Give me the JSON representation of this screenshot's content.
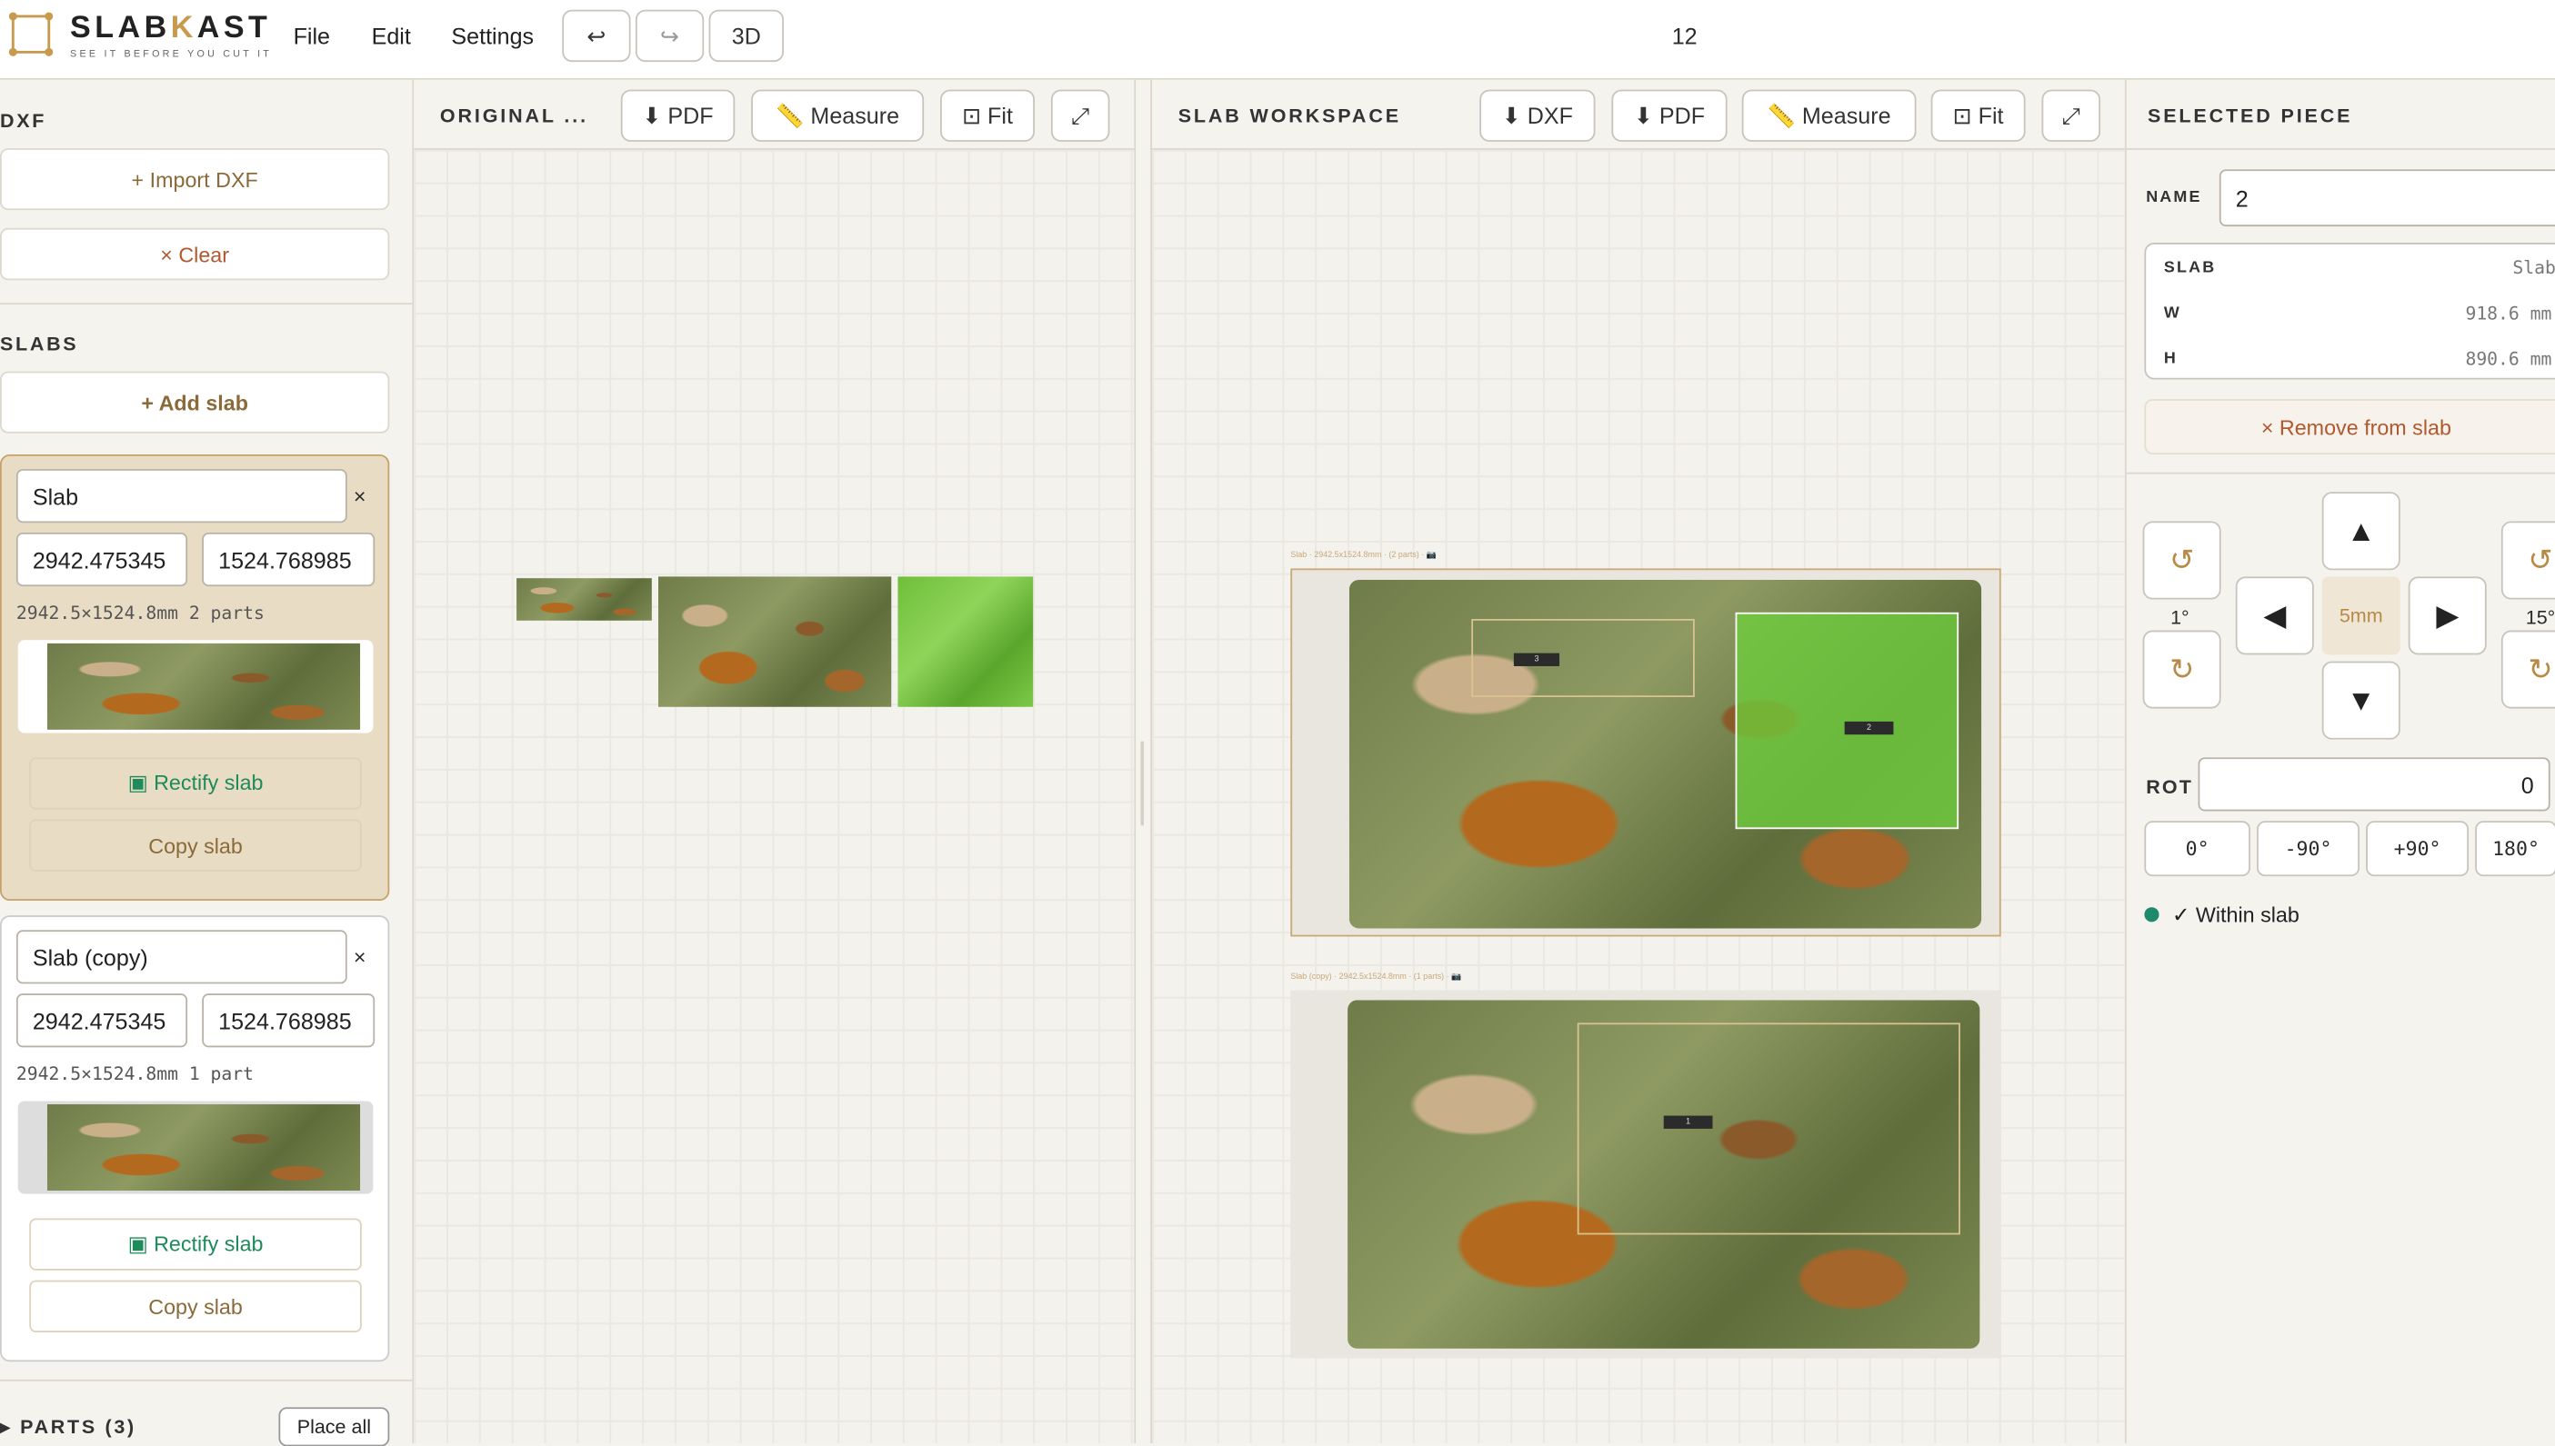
{
  "app": {
    "name_main": "SLAB",
    "name_accent": "K",
    "name_tail": "AST",
    "tagline": "SEE IT BEFORE YOU CUT IT",
    "menu": [
      "File",
      "Edit",
      "Settings"
    ],
    "undo_icon": "↩",
    "redo_icon": "↪",
    "btn_3d": "3D",
    "counter": "12"
  },
  "left": {
    "dxf_title": "DXF",
    "import_dxf": "+ Import DXF",
    "clear": "× Clear",
    "slabs_title": "SLABS",
    "add_slab": "+ Add slab",
    "slabs": [
      {
        "name": "Slab",
        "width": "2942.475345",
        "height": "1524.768985",
        "info": "2942.5×1524.8mm 2 parts",
        "rectify": "▣ Rectify slab",
        "copy": "Copy slab",
        "remove": "×"
      },
      {
        "name": "Slab (copy)",
        "width": "2942.475345",
        "height": "1524.768985",
        "info": "2942.5×1524.8mm 1 part",
        "rectify": "▣ Rectify slab",
        "copy": "Copy slab",
        "remove": "×"
      }
    ],
    "parts_title": "▸ PARTS (3)",
    "place_all": "Place all"
  },
  "original": {
    "title": "ORIGINAL ...",
    "pdf": "⬇ PDF",
    "measure": "📏 Measure",
    "fit": "⊡ Fit",
    "expand": "⤢"
  },
  "workspace": {
    "title": "SLAB WORKSPACE",
    "dxf": "⬇ DXF",
    "pdf": "⬇ PDF",
    "measure": "📏 Measure",
    "fit": "⊡ Fit",
    "expand": "⤢",
    "slab1_caption": "Slab · 2942.5x1524.8mm · (2 parts) · 📷",
    "slab2_caption": "Slab (copy) · 2942.5x1524.8mm · (1 parts) · 📷",
    "piece3_label": "3",
    "piece2_label": "2",
    "piece1_label": "1"
  },
  "selected": {
    "title": "SELECTED PIECE",
    "name_label": "NAME",
    "name_value": "2",
    "slab_label": "SLAB",
    "slab_value": "Slab",
    "w_label": "W",
    "w_value": "918.6 mm",
    "h_label": "H",
    "h_value": "890.6 mm",
    "remove": "× Remove from slab",
    "rot_ccw_icon": "↺",
    "rot_cw_icon": "↻",
    "step_deg_small": "1°",
    "step_deg_large": "15°",
    "up": "▲",
    "down": "▼",
    "leftarrow": "◀",
    "rightarrow": "▶",
    "step": "5mm",
    "rot_label": "ROT",
    "rot_value": "0",
    "rot_presets": [
      "0°",
      "-90°",
      "+90°",
      "180°"
    ],
    "status": "✓ Within slab",
    "status_color": "#1f8a6b"
  }
}
